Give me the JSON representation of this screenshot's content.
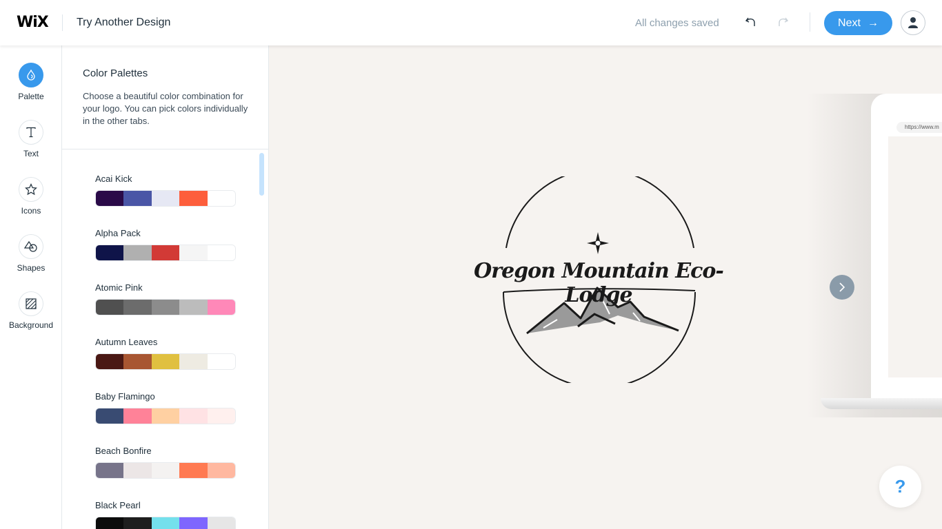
{
  "header": {
    "brand": "WiX",
    "title": "Try Another Design",
    "status": "All changes saved",
    "next_label": "Next",
    "next_arrow": "→",
    "undo_icon": "undo-icon",
    "redo_icon": "redo-icon",
    "avatar_icon": "user-icon",
    "accent_color": "#3899ec"
  },
  "tools": [
    {
      "label": "Palette",
      "icon": "palette-drop-icon",
      "active": true
    },
    {
      "label": "Text",
      "icon": "text-icon",
      "active": false
    },
    {
      "label": "Icons",
      "icon": "star-icon",
      "active": false
    },
    {
      "label": "Shapes",
      "icon": "shapes-icon",
      "active": false
    },
    {
      "label": "Background",
      "icon": "background-hatch-icon",
      "active": false
    }
  ],
  "panel": {
    "title": "Color Palettes",
    "description": "Choose a beautiful color combination for your logo. You can pick colors individually in the other tabs.",
    "palettes": [
      {
        "name": "Acai Kick",
        "colors": [
          "#2a0a48",
          "#4a56a6",
          "#e6e8f4",
          "#fd5e3c",
          "#ffffff"
        ]
      },
      {
        "name": "Alpha Pack",
        "colors": [
          "#0f1449",
          "#b0b0b0",
          "#d23a36",
          "#f5f5f5",
          "#ffffff"
        ]
      },
      {
        "name": "Atomic Pink",
        "colors": [
          "#505050",
          "#6c6c6c",
          "#8c8c8c",
          "#bcbcbc",
          "#ff88b8"
        ]
      },
      {
        "name": "Autumn Leaves",
        "colors": [
          "#4a1814",
          "#a85632",
          "#e0c040",
          "#eeebe2",
          "#ffffff"
        ]
      },
      {
        "name": "Baby Flamingo",
        "colors": [
          "#394b72",
          "#ff8298",
          "#ffd0a2",
          "#ffe2e4",
          "#fff0ee"
        ]
      },
      {
        "name": "Beach Bonfire",
        "colors": [
          "#77748a",
          "#ece6e6",
          "#f4f2f1",
          "#ff7a52",
          "#ffb8a0"
        ]
      },
      {
        "name": "Black Pearl",
        "colors": [
          "#0c0c0c",
          "#1e1e1e",
          "#74e0ec",
          "#7e66fe",
          "#e6e6e6"
        ]
      }
    ]
  },
  "canvas": {
    "logo_text": "Oregon Mountain Eco-Lodge",
    "preview_url": "https://www.m",
    "preview_next_icon": "chevron-right-icon",
    "help_label": "?"
  }
}
